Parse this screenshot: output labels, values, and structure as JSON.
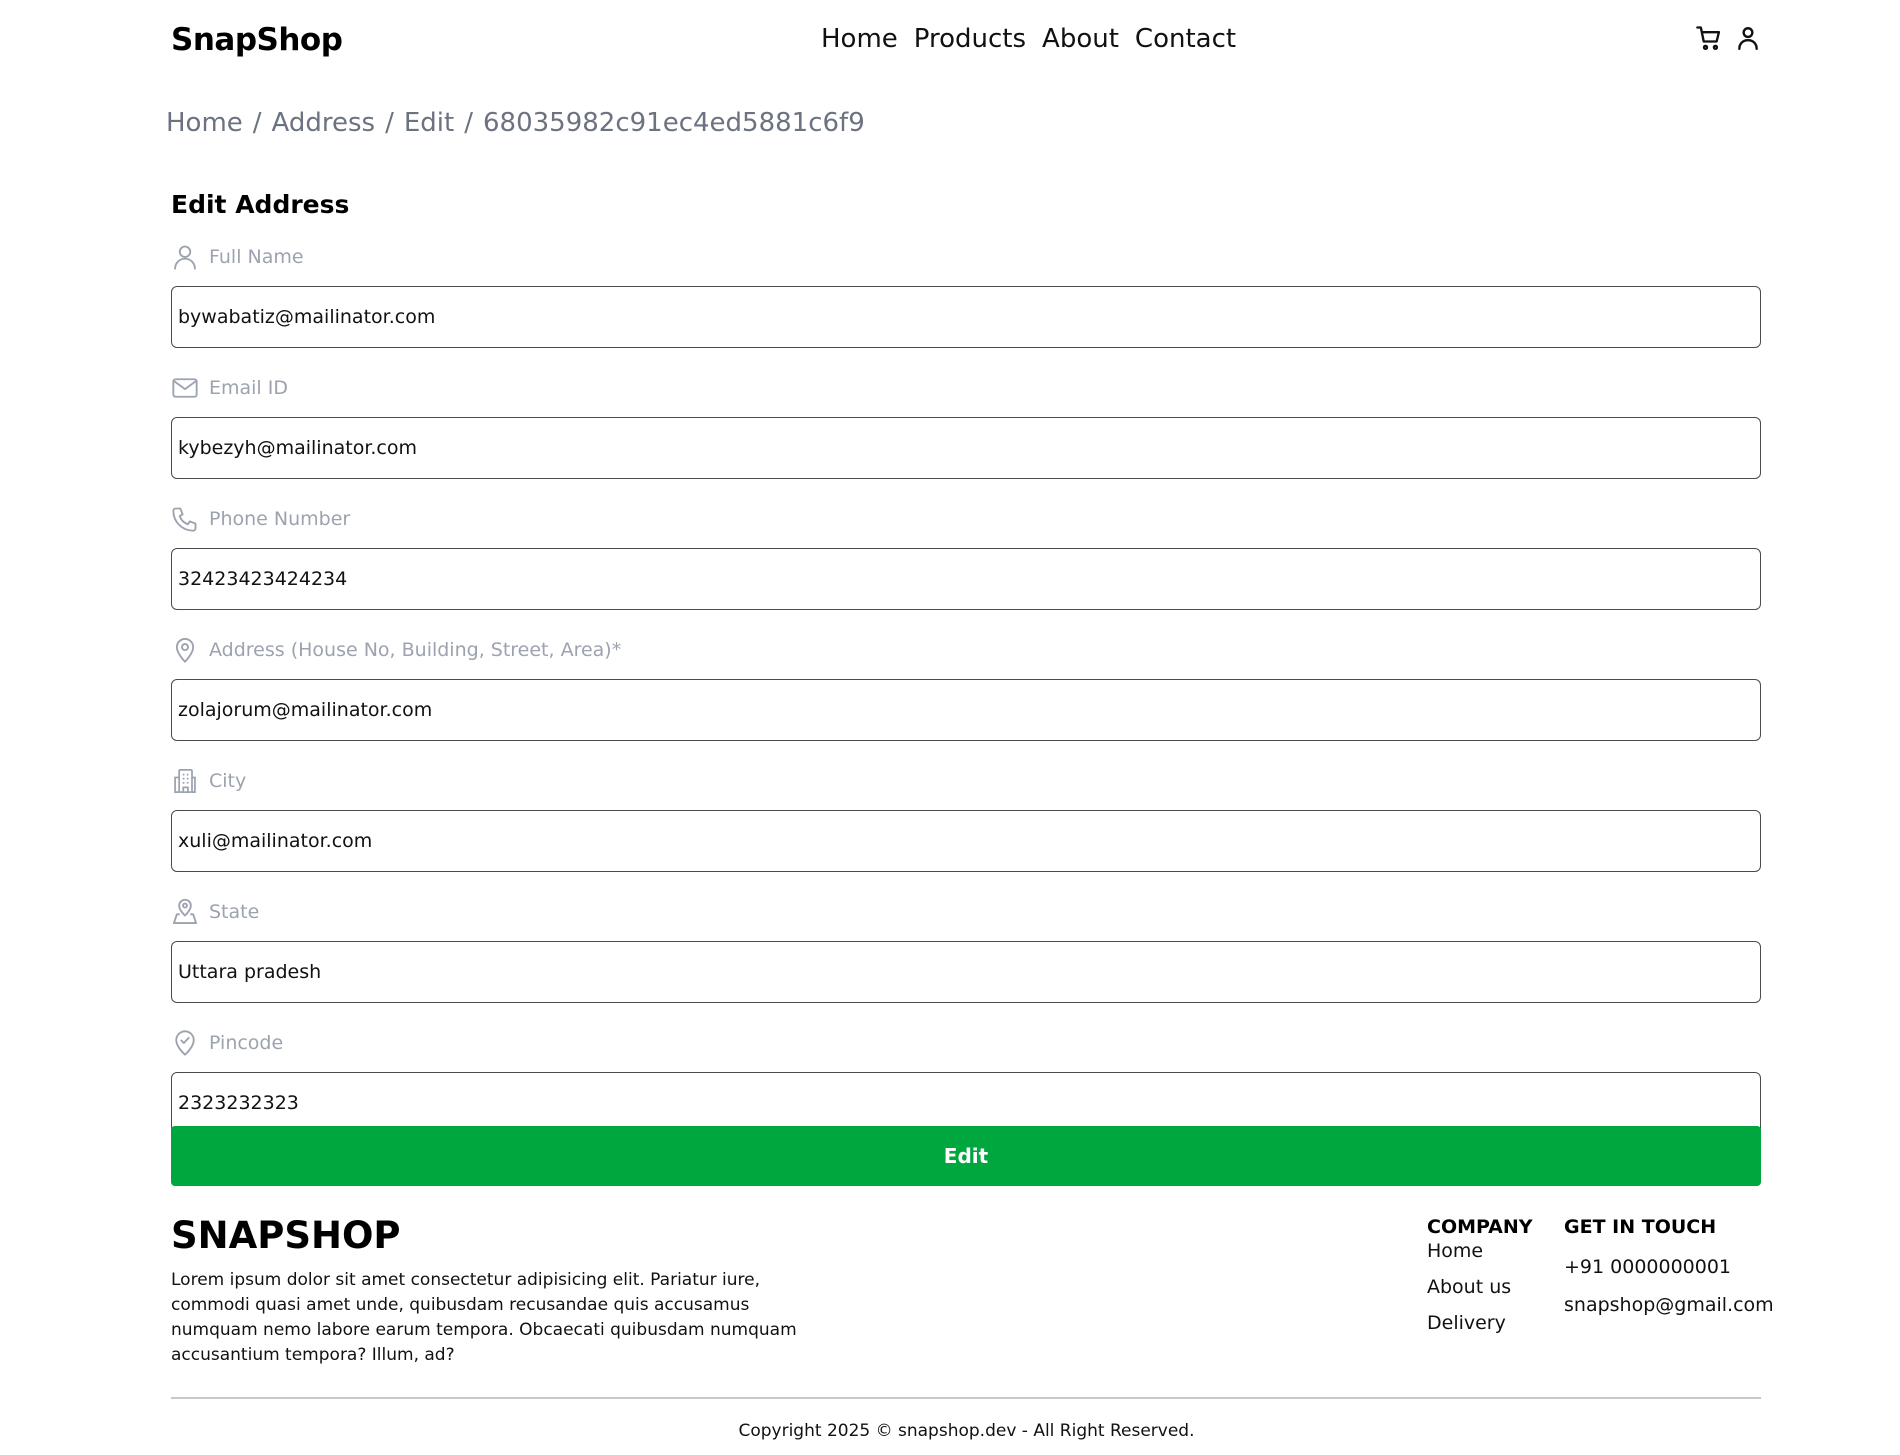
{
  "header": {
    "logo": "SnapShop",
    "nav": [
      "Home",
      "Products",
      "About",
      "Contact"
    ],
    "icons": [
      "cart-icon",
      "user-icon"
    ]
  },
  "breadcrumb": {
    "items": [
      "Home",
      "Address",
      "Edit",
      "68035982c91ec4ed5881c6f9"
    ],
    "separator": "/"
  },
  "form": {
    "title": "Edit Address",
    "fields": [
      {
        "label": "Full Name",
        "icon": "user-icon",
        "value": "bywabatiz@mailinator.com"
      },
      {
        "label": "Email ID",
        "icon": "mail-icon",
        "value": "kybezyh@mailinator.com"
      },
      {
        "label": "Phone Number",
        "icon": "phone-icon",
        "value": "32423423424234"
      },
      {
        "label": "Address (House No, Building, Street, Area)*",
        "icon": "map-pin-icon",
        "value": "zolajorum@mailinator.com"
      },
      {
        "label": "City",
        "icon": "building-icon",
        "value": "xuli@mailinator.com"
      },
      {
        "label": "State",
        "icon": "user-location-icon",
        "value": "Uttara pradesh"
      },
      {
        "label": "Pincode",
        "icon": "pin-check-icon",
        "value": "2323232323"
      }
    ],
    "submit_label": "Edit",
    "accent_color": "#00a63e"
  },
  "footer": {
    "brand": "SNAPSHOP",
    "description": "Lorem ipsum dolor sit amet consectetur adipisicing elit. Pariatur iure, commodi quasi amet unde, quibusdam recusandae quis accusamus numquam nemo labore earum tempora. Obcaecati quibusdam numquam accusantium tempora? Illum, ad?",
    "company": {
      "heading": "COMPANY",
      "links": [
        "Home",
        "About us",
        "Delivery"
      ]
    },
    "contact": {
      "heading": "GET IN TOUCH",
      "phone": "+91 0000000001",
      "email": "snapshop@gmail.com"
    },
    "copyright": "Copyright 2025 © snapshop.dev - All Right Reserved."
  }
}
